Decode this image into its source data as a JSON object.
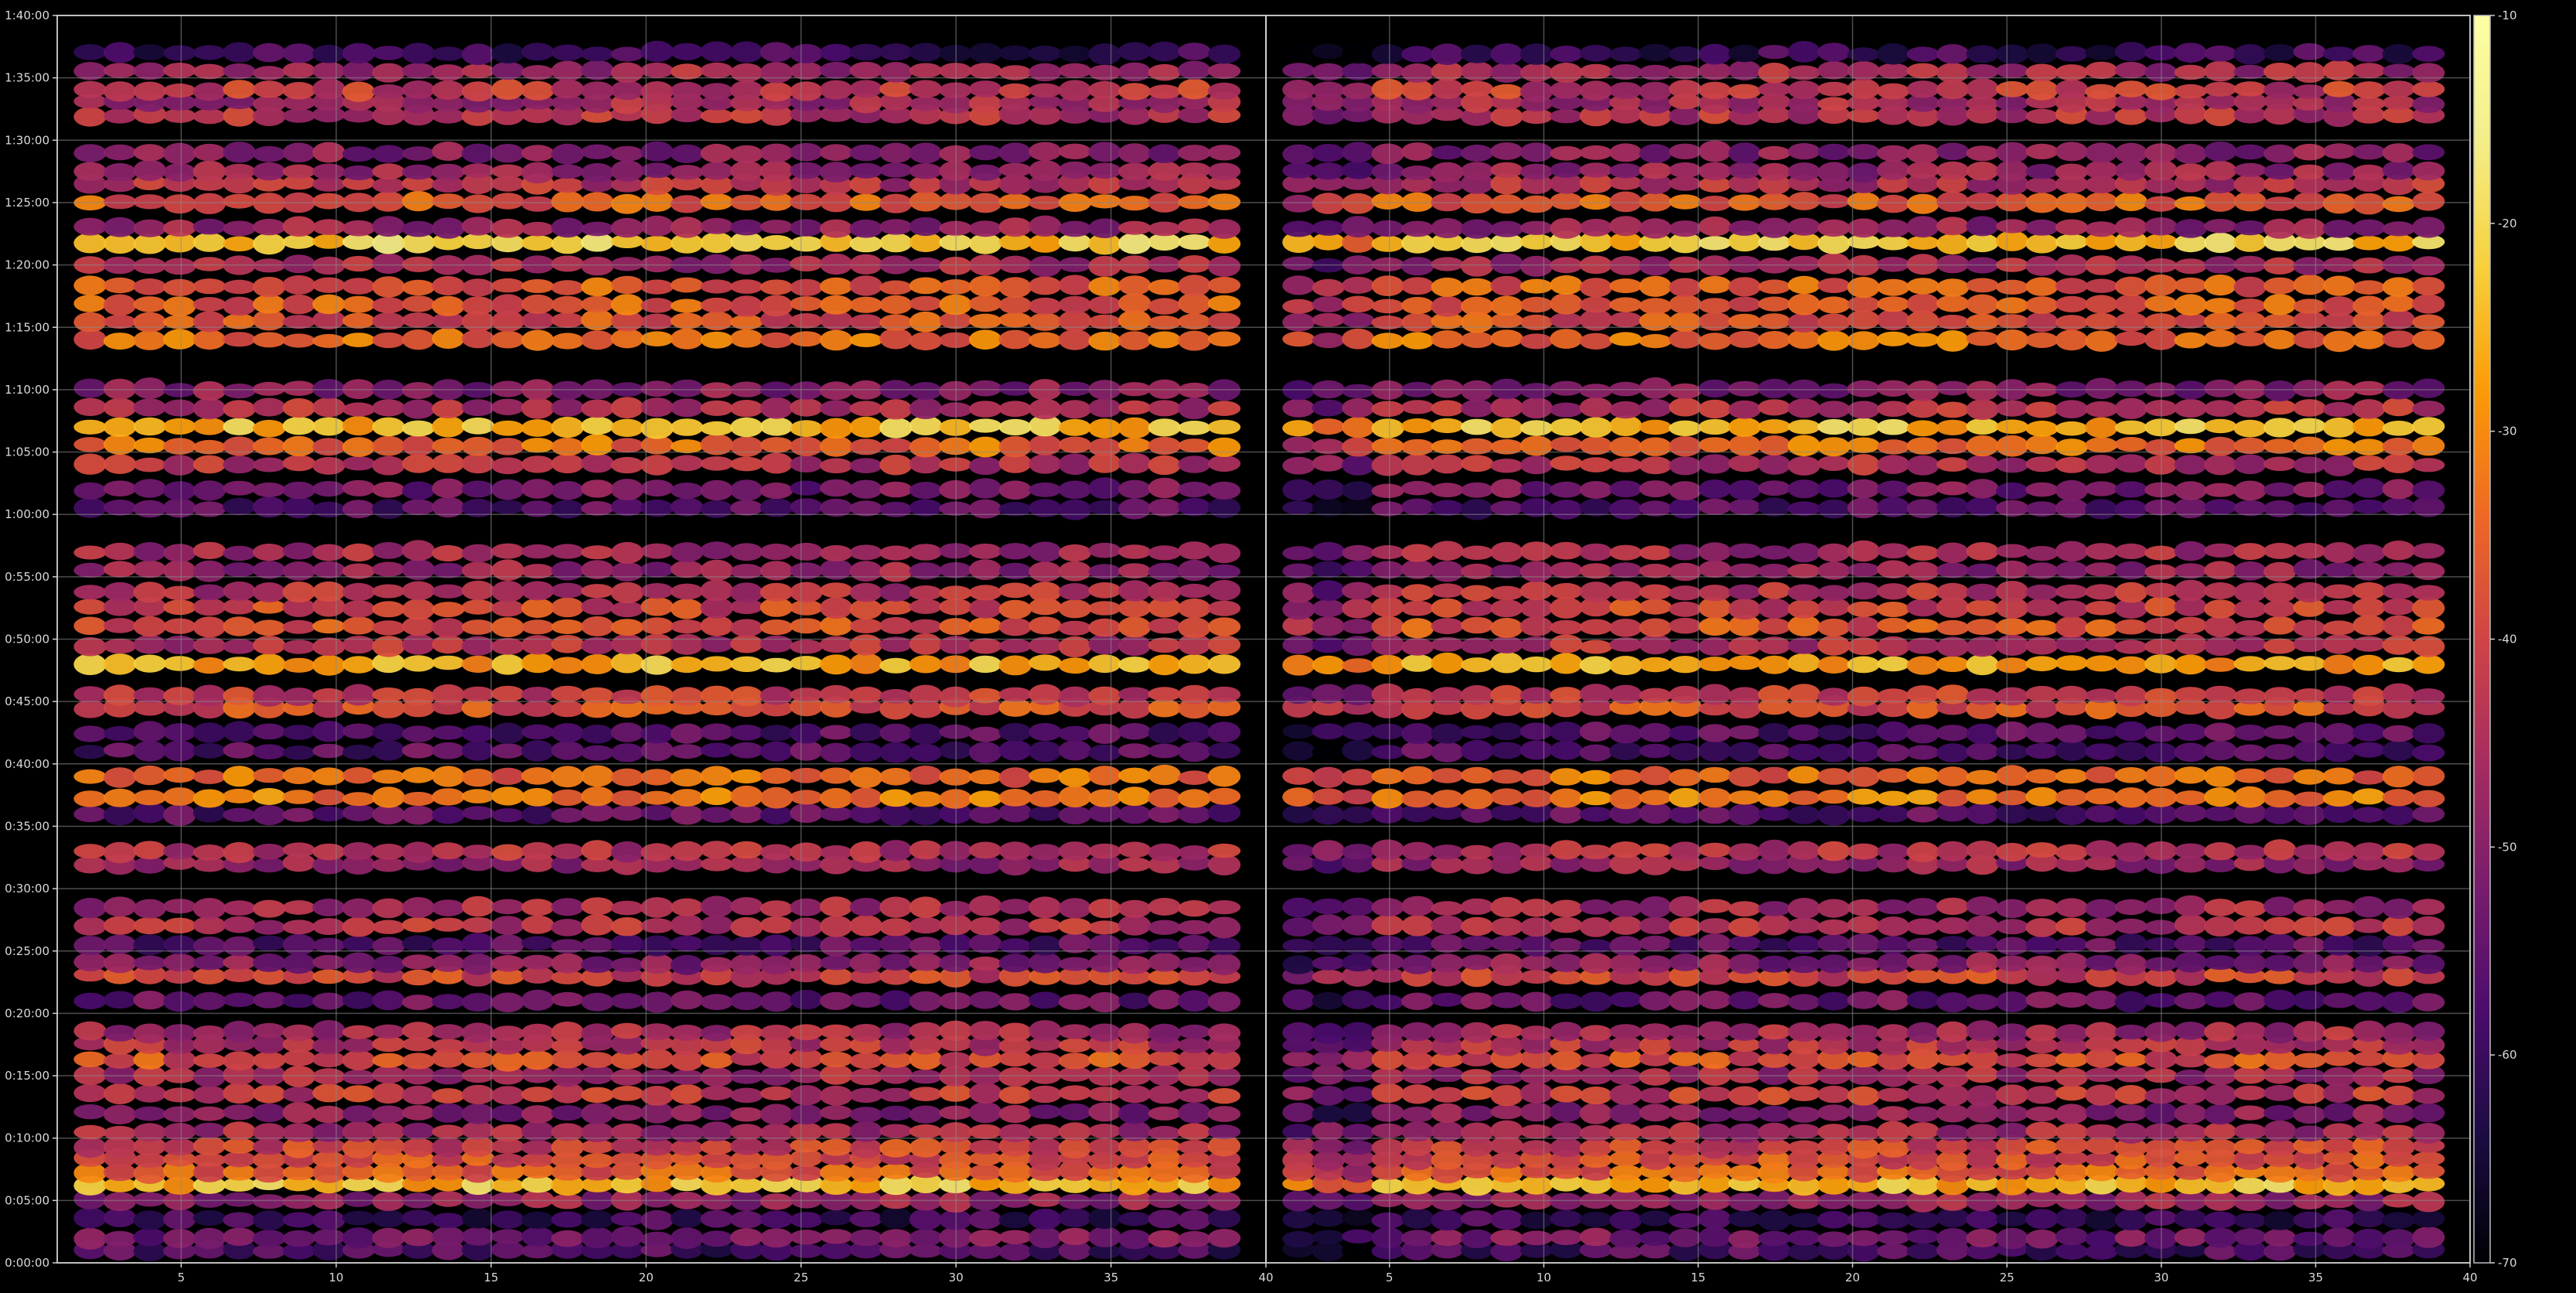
{
  "chart_data": {
    "type": "heatmap",
    "title": "",
    "xlabel": "",
    "ylabel": "",
    "grid": true,
    "colormap": "inferno",
    "background": "#000000",
    "grid_color": "#8a8a8a",
    "panels": [
      {
        "xlim": [
          1,
          40
        ],
        "x_ticks": [
          "5",
          "10",
          "15",
          "20",
          "25",
          "30",
          "35",
          "40"
        ]
      },
      {
        "xlim": [
          1,
          40
        ],
        "x_ticks": [
          "5",
          "10",
          "15",
          "20",
          "25",
          "30",
          "35",
          "40"
        ]
      }
    ],
    "y_ticks": [
      "0:00:00",
      "0:05:00",
      "0:10:00",
      "0:15:00",
      "0:20:00",
      "0:25:00",
      "0:30:00",
      "0:35:00",
      "0:40:00",
      "0:45:00",
      "0:50:00",
      "0:55:00",
      "1:00:00",
      "1:05:00",
      "1:10:00",
      "1:15:00",
      "1:20:00",
      "1:25:00",
      "1:30:00",
      "1:35:00",
      "1:40:00"
    ],
    "ylim": [
      "0:00:00",
      "1:40:00"
    ],
    "colorbar": {
      "range": [
        -70,
        -10
      ],
      "ticks": [
        "-10",
        "-20",
        "-30",
        "-40",
        "-50",
        "-60",
        "-70"
      ]
    },
    "row_levels_minutes": [
      [
        1.0,
        -58
      ],
      [
        2.0,
        -52
      ],
      [
        3.5,
        -60
      ],
      [
        5.0,
        -48
      ],
      [
        6.3,
        -24
      ],
      [
        7.3,
        -36
      ],
      [
        8.3,
        -38
      ],
      [
        9.3,
        -40
      ],
      [
        10.5,
        -46
      ],
      [
        12.0,
        -50
      ],
      [
        13.5,
        -42
      ],
      [
        15.0,
        -46
      ],
      [
        16.3,
        -38
      ],
      [
        17.5,
        -44
      ],
      [
        18.5,
        -46
      ],
      [
        21.0,
        -54
      ],
      [
        23.0,
        -40
      ],
      [
        24.0,
        -50
      ],
      [
        25.5,
        -56
      ],
      [
        27.0,
        -44
      ],
      [
        28.5,
        -46
      ],
      [
        32.0,
        -48
      ],
      [
        33.0,
        -44
      ],
      [
        36.0,
        -56
      ],
      [
        37.3,
        -32
      ],
      [
        39.0,
        -34
      ],
      [
        41.0,
        -56
      ],
      [
        42.5,
        -56
      ],
      [
        44.5,
        -38
      ],
      [
        45.5,
        -42
      ],
      [
        48.0,
        -26
      ],
      [
        49.5,
        -44
      ],
      [
        51.0,
        -38
      ],
      [
        52.5,
        -40
      ],
      [
        53.8,
        -44
      ],
      [
        55.5,
        -48
      ],
      [
        57.0,
        -46
      ],
      [
        60.5,
        -56
      ],
      [
        62.0,
        -52
      ],
      [
        64.0,
        -44
      ],
      [
        65.5,
        -34
      ],
      [
        67.0,
        -24
      ],
      [
        68.5,
        -44
      ],
      [
        70.0,
        -50
      ],
      [
        74.0,
        -34
      ],
      [
        75.5,
        -38
      ],
      [
        76.8,
        -36
      ],
      [
        78.3,
        -36
      ],
      [
        80.0,
        -46
      ],
      [
        81.8,
        -22
      ],
      [
        83.0,
        -48
      ],
      [
        85.0,
        -36
      ],
      [
        86.5,
        -44
      ],
      [
        87.5,
        -48
      ],
      [
        89.0,
        -50
      ],
      [
        92.0,
        -44
      ],
      [
        93.0,
        -46
      ],
      [
        94.0,
        -42
      ],
      [
        95.5,
        -46
      ],
      [
        97.0,
        -60
      ]
    ]
  }
}
